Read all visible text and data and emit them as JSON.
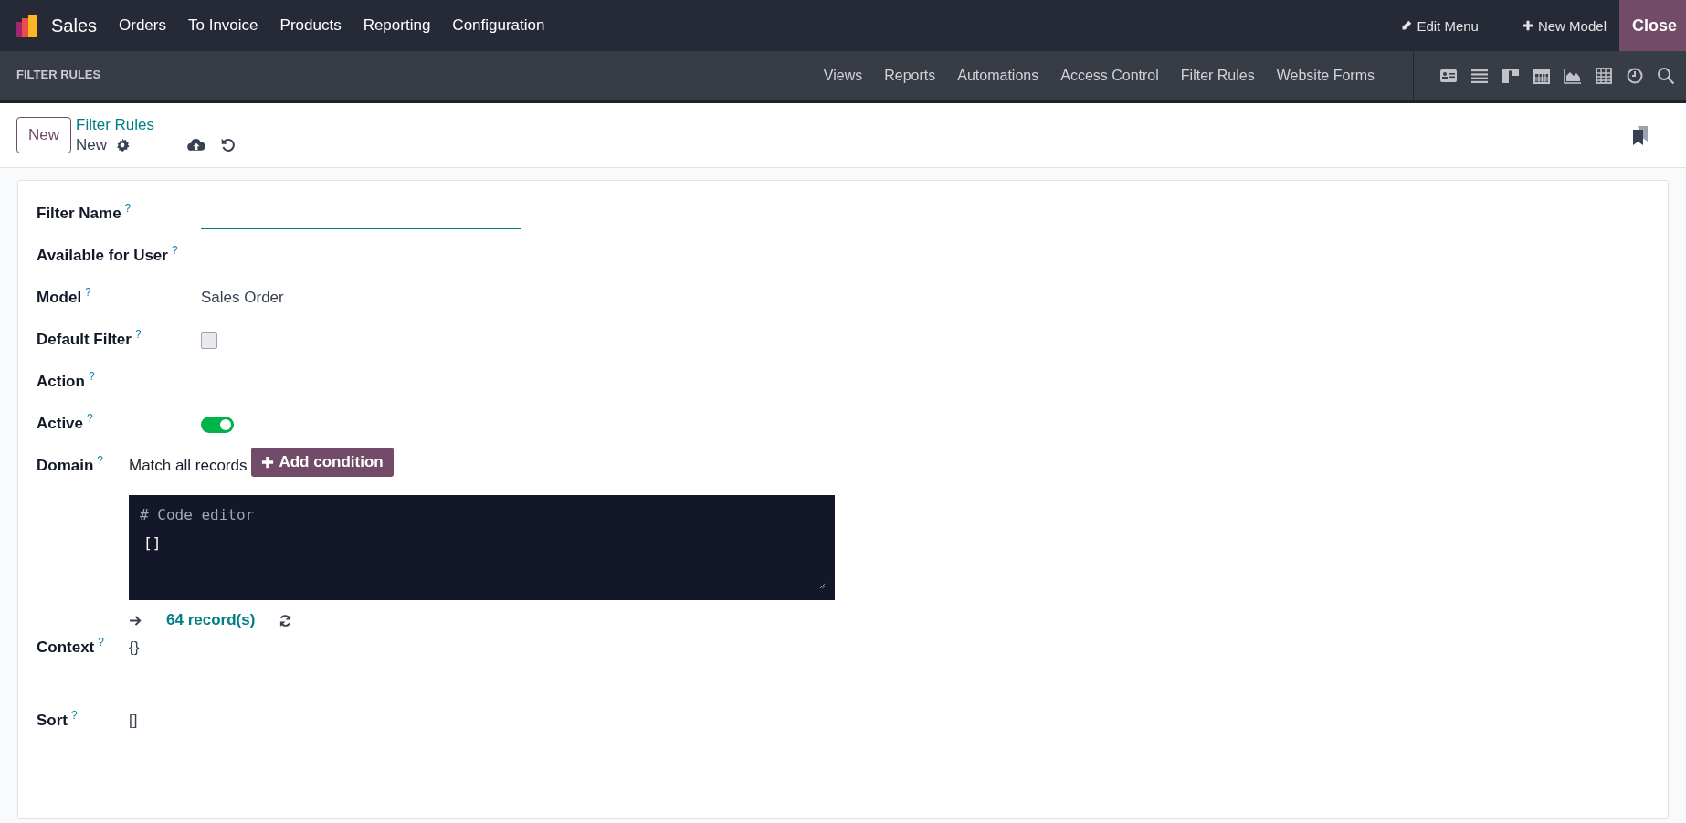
{
  "navbar": {
    "app_name": "Sales",
    "menu": [
      "Orders",
      "To Invoice",
      "Products",
      "Reporting",
      "Configuration"
    ],
    "actions": [
      {
        "kind": "edit",
        "label": "Edit Menu"
      },
      {
        "kind": "add",
        "label": "New Model"
      }
    ],
    "close": "Close"
  },
  "studio_bar": {
    "title": "FILTER RULES",
    "menu": [
      "Views",
      "Reports",
      "Automations",
      "Access Control",
      "Filter Rules",
      "Website Forms"
    ]
  },
  "control_panel": {
    "new_button": "New",
    "breadcrumb": "Filter Rules",
    "record": "New"
  },
  "form": {
    "fields": [
      {
        "kind": "input",
        "label": "Filter Name",
        "help": "?"
      },
      {
        "kind": "empty",
        "label": "Available for User",
        "help": "?"
      },
      {
        "kind": "text",
        "label": "Model",
        "help": "?",
        "value": "Sales Order"
      },
      {
        "kind": "checkbox",
        "label": "Default Filter",
        "help": "?",
        "checked": false
      },
      {
        "kind": "empty",
        "label": "Action",
        "help": "?"
      },
      {
        "kind": "toggle",
        "label": "Active",
        "help": "?",
        "on": true
      },
      {
        "kind": "domain",
        "label": "Domain",
        "help": "?",
        "match": "Match",
        "scope": "all records",
        "add_button": "Add condition",
        "editor_hint": "# Code editor",
        "editor_code": "[]",
        "count": "64 record(s)"
      },
      {
        "kind": "code",
        "label": "Context",
        "help": "?",
        "value": "{}"
      },
      {
        "kind": "code",
        "label": "Sort",
        "help": "?",
        "value": "[]"
      }
    ]
  }
}
